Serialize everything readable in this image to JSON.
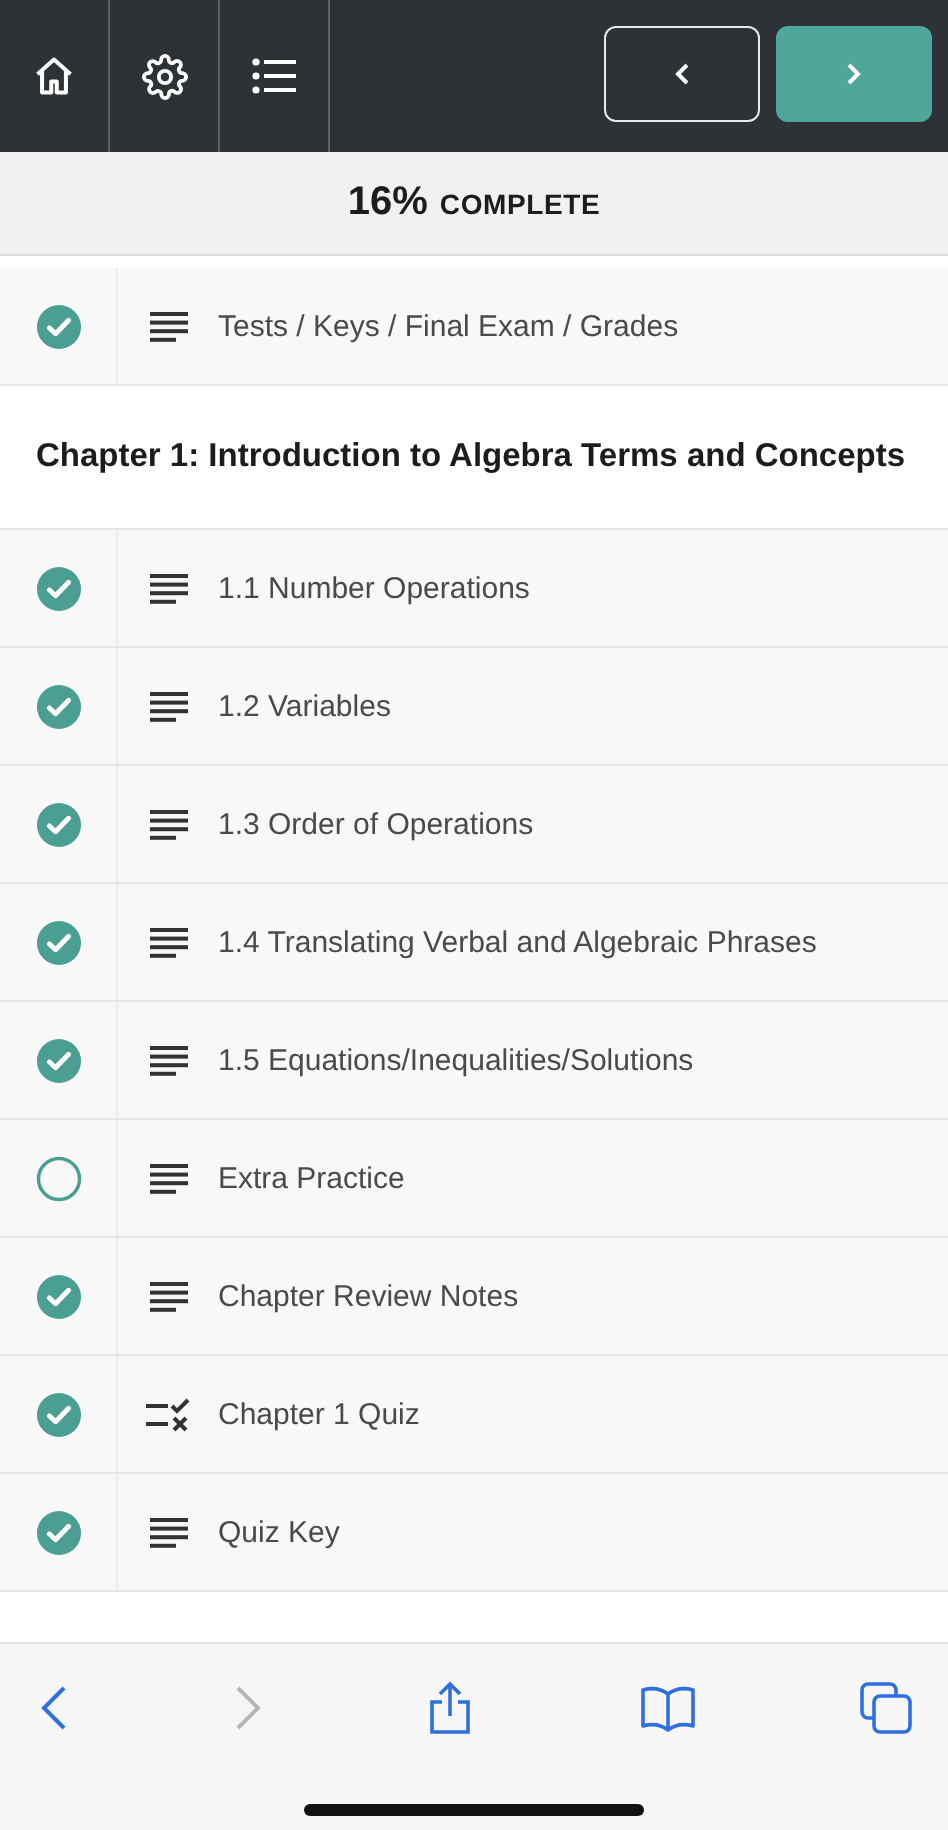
{
  "progress": {
    "percent": "16%",
    "label": "COMPLETE"
  },
  "top_lessons": [
    {
      "title": "Tests / Keys / Final Exam / Grades",
      "kind": "lesson",
      "completed": true
    }
  ],
  "chapter": {
    "title": "Chapter 1: Introduction to Algebra Terms and Concepts",
    "lessons": [
      {
        "title": "1.1 Number Operations",
        "kind": "lesson",
        "completed": true
      },
      {
        "title": "1.2 Variables",
        "kind": "lesson",
        "completed": true
      },
      {
        "title": "1.3 Order of Operations",
        "kind": "lesson",
        "completed": true
      },
      {
        "title": "1.4 Translating Verbal and Algebraic Phrases",
        "kind": "lesson",
        "completed": true
      },
      {
        "title": "1.5 Equations/Inequalities/Solutions",
        "kind": "lesson",
        "completed": true
      },
      {
        "title": "Extra Practice",
        "kind": "lesson",
        "completed": false
      },
      {
        "title": "Chapter Review Notes",
        "kind": "lesson",
        "completed": true
      },
      {
        "title": "Chapter 1 Quiz",
        "kind": "quiz",
        "completed": true
      },
      {
        "title": "Quiz Key",
        "kind": "lesson",
        "completed": true
      }
    ]
  },
  "browser_bar": {
    "back_disabled": false,
    "forward_disabled": true
  }
}
